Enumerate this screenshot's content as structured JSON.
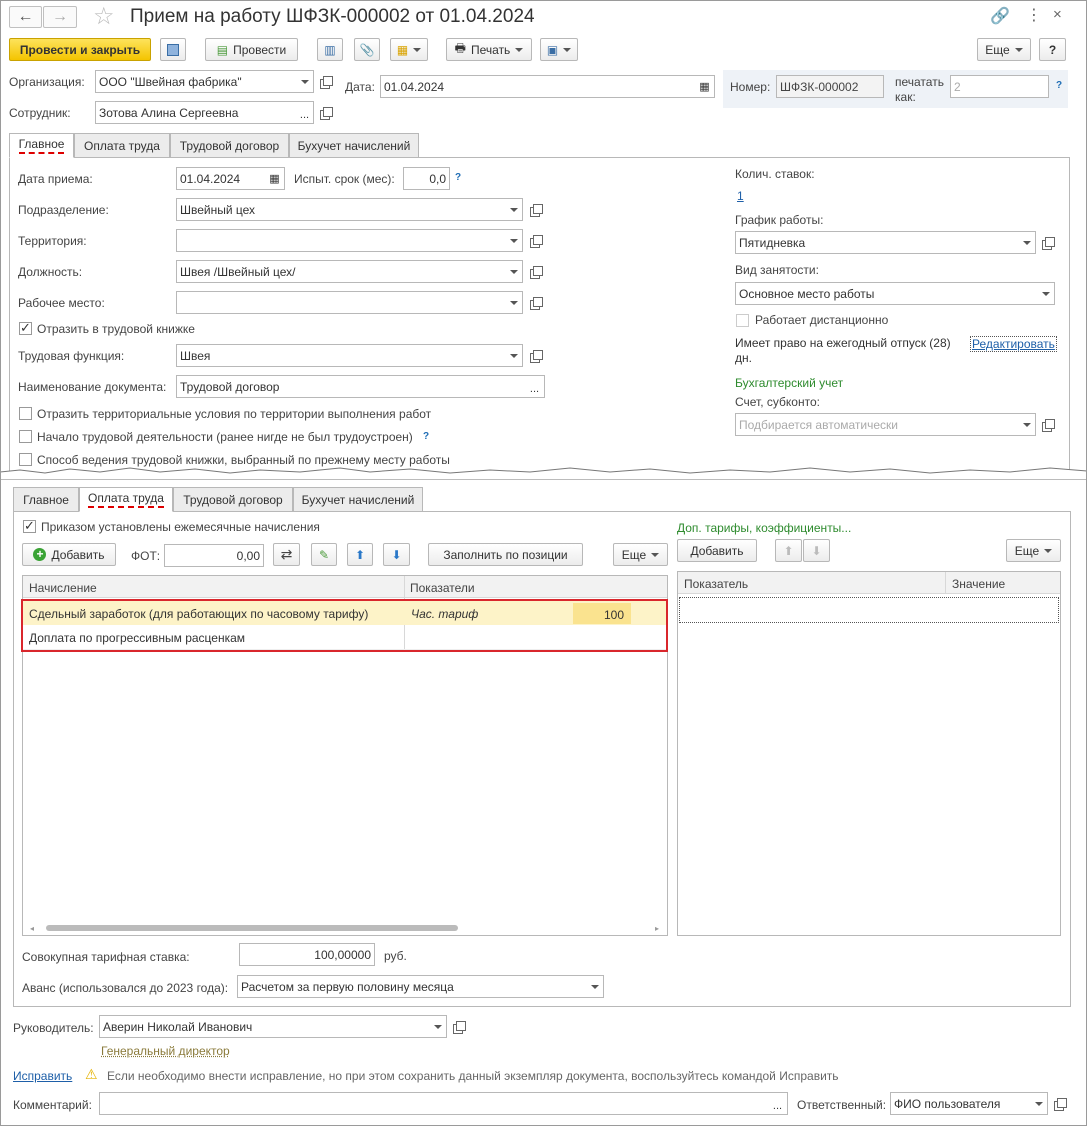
{
  "window": {
    "title": "Прием на работу ШФЗК-000002 от 01.04.2024"
  },
  "toolbar": {
    "post_close": "Провести и закрыть",
    "post": "Провести",
    "print": "Печать",
    "more": "Еще",
    "help": "?"
  },
  "header": {
    "org_label": "Организация:",
    "org_value": "ООО \"Швейная фабрика\"",
    "date_label": "Дата:",
    "date_value": "01.04.2024",
    "number_label": "Номер:",
    "number_value": "ШФЗК-000002",
    "print_as_label": "печатать как:",
    "print_as_value": "2",
    "employee_label": "Сотрудник:",
    "employee_value": "Зотова Алина Сергеевна"
  },
  "tabs_top": [
    "Главное",
    "Оплата труда",
    "Трудовой договор",
    "Бухучет начислений"
  ],
  "main": {
    "hire_date_label": "Дата приема:",
    "hire_date": "01.04.2024",
    "probation_label": "Испыт. срок (мес):",
    "probation": "0,0",
    "dept_label": "Подразделение:",
    "dept": "Швейный цех",
    "territory_label": "Территория:",
    "territory": "",
    "position_label": "Должность:",
    "position": "Швея /Швейный цех/",
    "workplace_label": "Рабочее место:",
    "workplace": "",
    "book_check": "Отразить в трудовой книжке",
    "function_label": "Трудовая функция:",
    "function": "Швея",
    "docname_label": "Наименование документа:",
    "docname": "Трудовой договор",
    "check_terr": "Отразить территориальные условия по территории выполнения работ",
    "check_start": "Начало трудовой деятельности (ранее нигде не был трудоустроен)",
    "check_way": "Способ ведения трудовой книжки, выбранный по прежнему месту работы",
    "rates_label": "Колич. ставок:",
    "rates": "1",
    "schedule_label": "График работы:",
    "schedule": "Пятидневка",
    "employment_label": "Вид занятости:",
    "employment": "Основное место работы",
    "remote_label": "Работает дистанционно",
    "vacation_text": "Имеет право на ежегодный отпуск (28) дн.",
    "vacation_edit": "Редактировать",
    "accounting_title": "Бухгалтерский учет",
    "account_label": "Счет, субконто:",
    "account_placeholder": "Подбирается автоматически"
  },
  "tabs_bottom": [
    "Главное",
    "Оплата труда",
    "Трудовой договор",
    "Бухучет начислений"
  ],
  "pay": {
    "monthly_check": "Приказом установлены ежемесячные начисления",
    "add": "Добавить",
    "fot_label": "ФОТ:",
    "fot": "0,00",
    "fill": "Заполнить по позиции",
    "more": "Еще",
    "col1": "Начисление",
    "col2": "Показатели",
    "rows": [
      {
        "name": "Сдельный заработок (для работающих по часовому тарифу)",
        "indicator": "Час. тариф",
        "value": "100"
      },
      {
        "name": "Доплата по прогрессивным расценкам",
        "indicator": "",
        "value": ""
      }
    ],
    "extra_title": "Доп. тарифы, коэффициенты...",
    "extra_add": "Добавить",
    "extra_more": "Еще",
    "extra_col1": "Показатель",
    "extra_col2": "Значение",
    "total_label": "Совокупная тарифная ставка:",
    "total": "100,00000",
    "currency": "руб.",
    "advance_label": "Аванс (использовался до 2023 года):",
    "advance": "Расчетом за первую половину месяца"
  },
  "footer": {
    "head_label": "Руководитель:",
    "head": "Аверин Николай Иванович",
    "head_position": "Генеральный директор",
    "fix_link": "Исправить",
    "fix_note": "Если необходимо внести исправление, но при этом сохранить данный экземпляр документа, воспользуйтесь командой Исправить",
    "comment_label": "Комментарий:",
    "comment": "",
    "resp_label": "Ответственный:",
    "resp": "ФИО пользователя"
  },
  "colors": {
    "accent_yellow": "#f4c400",
    "highlight_row": "#fdf3c8",
    "red_box": "#d9262c",
    "link": "#1e5fa8",
    "green": "#2e8b2e"
  }
}
